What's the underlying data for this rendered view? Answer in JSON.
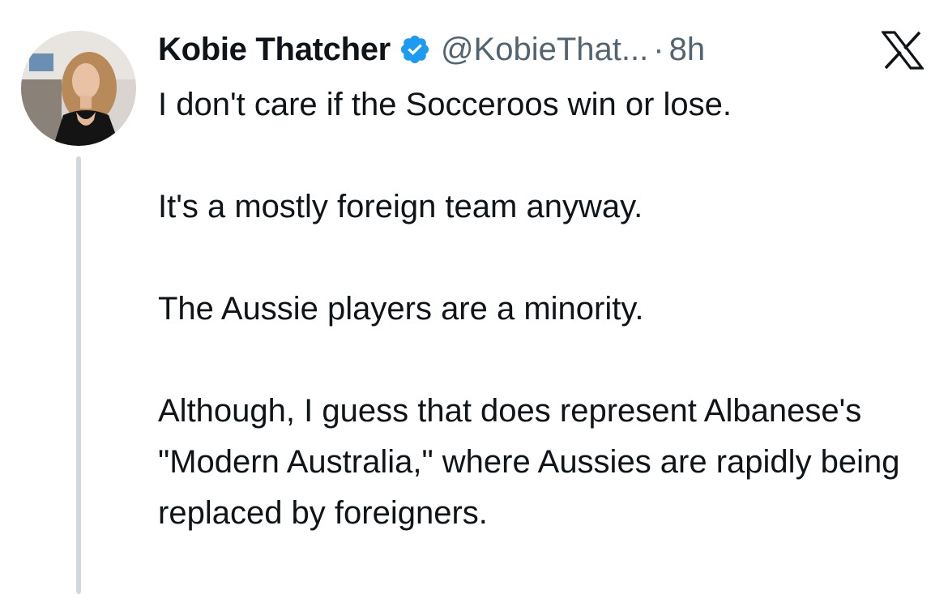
{
  "tweet": {
    "display_name": "Kobie Thatcher",
    "handle": "@KobieThat...",
    "separator": "·",
    "time": "8h",
    "paragraphs": [
      "I don't care if the Socceroos win or lose.",
      "It's a mostly foreign team anyway.",
      "The Aussie players are a minority.",
      "Although, I guess that does represent Albanese's \"Modern Australia,\" where Aussies are rapidly being replaced by foreigners."
    ]
  },
  "icons": {
    "verified": "verified-badge-icon",
    "brand": "x-logo-icon"
  },
  "colors": {
    "verified_blue": "#1d9bf0",
    "text_primary": "#0f1419",
    "text_secondary": "#536471",
    "thread_line": "#cfd9de"
  }
}
